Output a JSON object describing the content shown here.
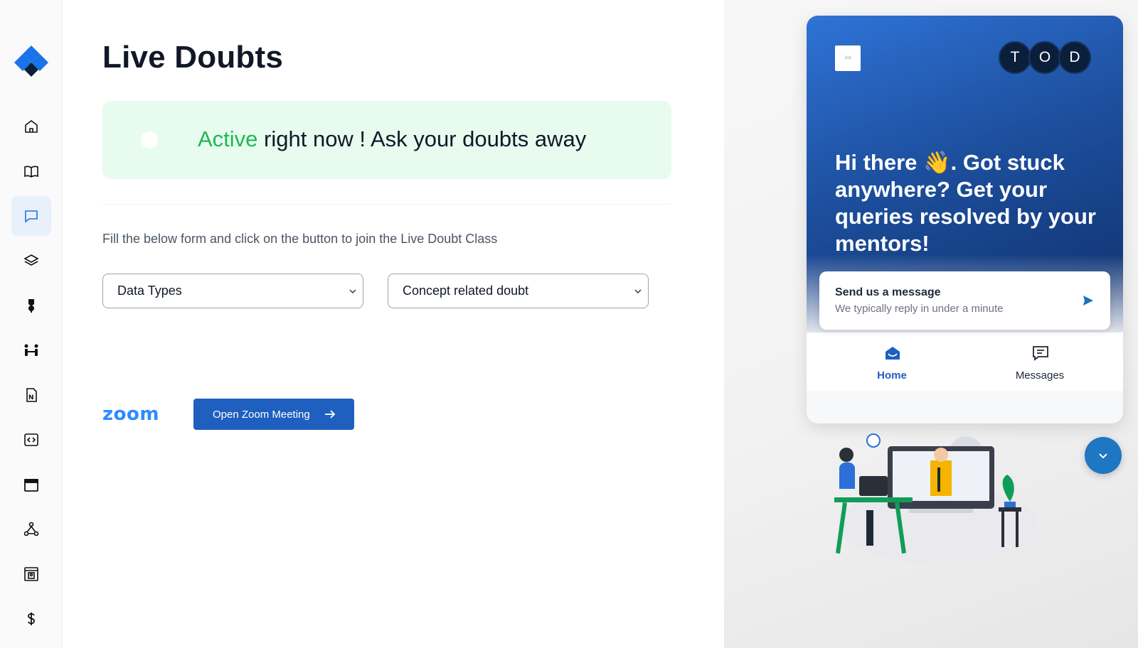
{
  "sidebar": {
    "logo": "brand-logo-diamond",
    "items": [
      {
        "icon": "home-icon",
        "active": false
      },
      {
        "icon": "book-icon",
        "active": false
      },
      {
        "icon": "chat-icon",
        "active": true
      },
      {
        "icon": "layers-icon",
        "active": false
      },
      {
        "icon": "medal-icon",
        "active": false
      },
      {
        "icon": "mentorship-icon",
        "active": false
      },
      {
        "icon": "notes-icon",
        "active": false
      },
      {
        "icon": "code-icon",
        "active": false
      },
      {
        "icon": "calendar-icon",
        "active": false
      },
      {
        "icon": "network-icon",
        "active": false
      },
      {
        "icon": "profile-card-icon",
        "active": false
      },
      {
        "icon": "dollar-icon",
        "active": false
      }
    ]
  },
  "main": {
    "title": "Live Doubts",
    "banner": {
      "active_word": "Active",
      "rest": " right now ! Ask your doubts away"
    },
    "instructions": "Fill the below form and click on the button to join the Live Doubt Class",
    "select_topic": "Data Types",
    "select_type": "Concept related doubt",
    "zoom_logo": "zoom",
    "zoom_button": "Open Zoom Meeting"
  },
  "widget": {
    "brand_text": "Job",
    "avatars": [
      "T",
      "O",
      "D"
    ],
    "greeting": "Hi there 👋. Got stuck anywhere? Get your queries resolved by your mentors!",
    "message_card": {
      "title": "Send us a message",
      "subtitle": "We typically reply in under a minute"
    },
    "tabs": {
      "home": "Home",
      "messages": "Messages"
    }
  },
  "colors": {
    "accent": "#1f5fbf",
    "active_green": "#1db954",
    "banner_bg": "#e7fbef",
    "widget_blue": "#2f73d6"
  }
}
